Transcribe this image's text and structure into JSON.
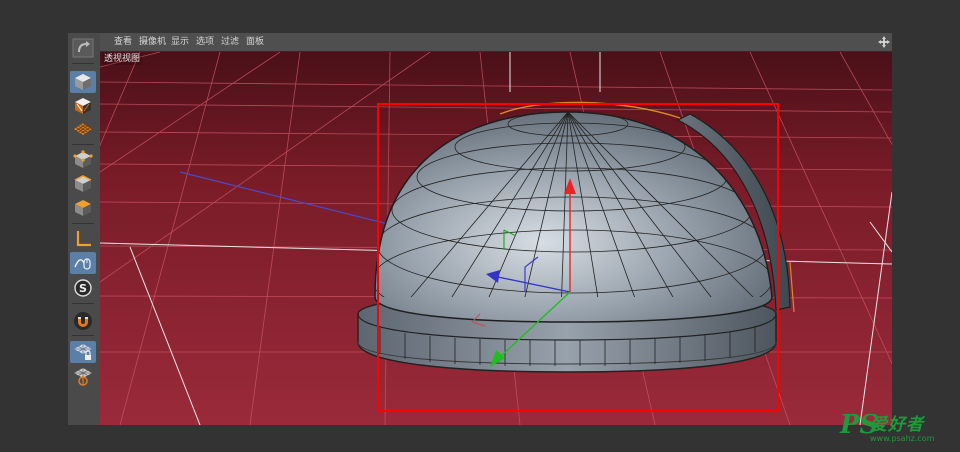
{
  "menu": {
    "items": [
      {
        "label": "查看"
      },
      {
        "label": "摄像机"
      },
      {
        "label": "显示"
      },
      {
        "label": "选项"
      },
      {
        "label": "过滤"
      },
      {
        "label": "面板"
      }
    ]
  },
  "viewport": {
    "label": "透视视图",
    "background_color": "#8e2230",
    "selection_box_color": "#ff0000"
  },
  "toolbar": {
    "tools": [
      {
        "icon": "undo-view-icon",
        "active": false
      },
      {
        "icon": "model-mode-icon",
        "active": true
      },
      {
        "icon": "object-mode-icon",
        "active": false
      },
      {
        "icon": "texture-mode-icon",
        "active": false
      },
      {
        "icon": "points-mode-icon",
        "active": false
      },
      {
        "icon": "edges-mode-icon",
        "active": false
      },
      {
        "icon": "polygons-mode-icon",
        "active": false
      },
      {
        "icon": "axis-mode-icon",
        "active": false
      },
      {
        "icon": "tweak-mode-icon",
        "active": true
      },
      {
        "icon": "solo-mode-icon",
        "active": false
      },
      {
        "icon": "snap-icon",
        "active": false
      },
      {
        "icon": "workplane-lock-icon",
        "active": true
      },
      {
        "icon": "planar-workplane-icon",
        "active": false
      }
    ]
  },
  "watermark": {
    "logo": "PS",
    "site_name": "爱好者",
    "url": "www.psahz.com"
  }
}
